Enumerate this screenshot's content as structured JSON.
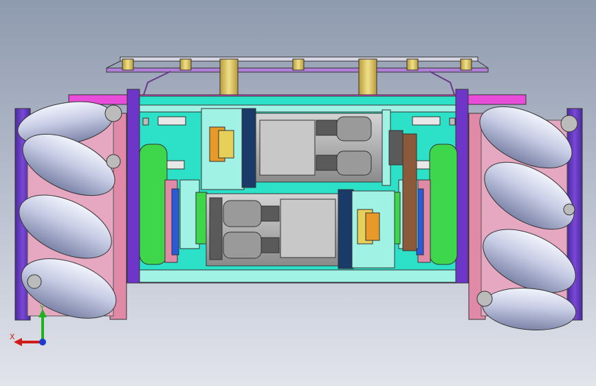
{
  "viewport": {
    "background_top": "#8e9aae",
    "background_bottom": "#e2e4ec"
  },
  "triad": {
    "x_label": "X",
    "y_label": "Y",
    "x_color": "#d11a1a",
    "y_color": "#1fb21f",
    "z_color": "#1a3ad1"
  },
  "colors": {
    "chassis_cyan": "#2de0c8",
    "chassis_light_cyan": "#9ff2e4",
    "frame_magenta": "#e84cd8",
    "wheel_plate_purple": "#6d35c8",
    "wheel_hub_pink": "#e08aa8",
    "roller_silver": "#c9cfe6",
    "motor_grey": "#b5b5b5",
    "motor_dark": "#5a5a5a",
    "gear_green": "#3ed64a",
    "pulley_orange": "#e89a28",
    "pulley_yellow": "#e6d05a",
    "bearing_blue": "#2a5ad8",
    "belt_brown": "#8a5a3a",
    "standoff_gold": "#d8c060",
    "deck_purple": "#b080d8",
    "bracket_navy": "#1a3a6a"
  }
}
